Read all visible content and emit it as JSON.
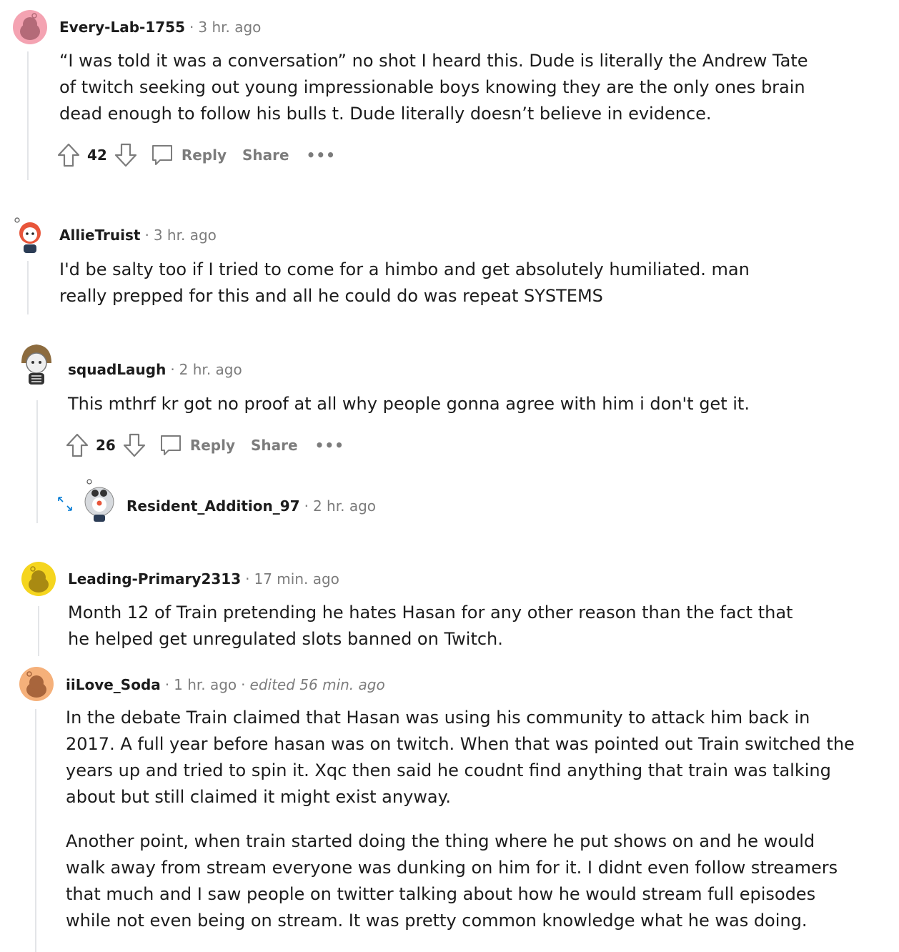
{
  "comments": [
    {
      "user": "Every-Lab-1755",
      "time": "3 hr. ago",
      "body": [
        "“I was told it was a conversation” no shot I heard this. Dude is literally the Andrew Tate of twitch seeking out young impressionable boys knowing they are the only ones brain dead enough to follow his bulls    t. Dude literally doesn’t believe in evidence."
      ],
      "votes": "42"
    },
    {
      "user": "AllieTruist",
      "time": "3 hr. ago",
      "body": [
        "I'd be salty too if I tried to come for a himbo and get absolutely humiliated. man really prepped for this and all he could do was repeat SYSTEMS"
      ]
    },
    {
      "user": "squadLaugh",
      "time": "2 hr. ago",
      "body": [
        "This mthrf    kr got no proof at all why people gonna agree with him i don't get it."
      ],
      "votes": "26"
    },
    {
      "user": "Resident_Addition_97",
      "time": "2 hr. ago"
    },
    {
      "user": "Leading-Primary2313",
      "time": "17 min. ago",
      "body": [
        "Month 12 of Train pretending he hates Hasan for any other reason than the fact that he helped get unregulated slots banned on Twitch."
      ]
    },
    {
      "user": "iiLove_Soda",
      "time": "1 hr. ago",
      "edited": "edited 56 min. ago",
      "body": [
        "In the debate Train claimed that Hasan was using his community to attack him back in 2017. A full year before hasan was on twitch. When that was pointed out Train switched the years up and tried to spin it. Xqc then said he coudnt find anything that train was talking about but still claimed it might exist anyway.",
        "Another point, when train started doing the thing where he put shows on and he would walk away from stream everyone was dunking on him for it. I didnt even follow streamers that much and I saw people on twitter talking about how he would stream full episodes while not even being on stream. It was pretty common knowledge what he was doing."
      ]
    }
  ],
  "actions": {
    "reply": "Reply",
    "share": "Share",
    "more": "•••"
  },
  "separator": "·",
  "colors": {
    "avatar_pink": "#f4a3b2",
    "avatar_yellow": "#f5d51e",
    "avatar_orange": "#f5b07a",
    "thread_line": "#e3e5e8",
    "meta_gray": "#7c7c7c"
  }
}
